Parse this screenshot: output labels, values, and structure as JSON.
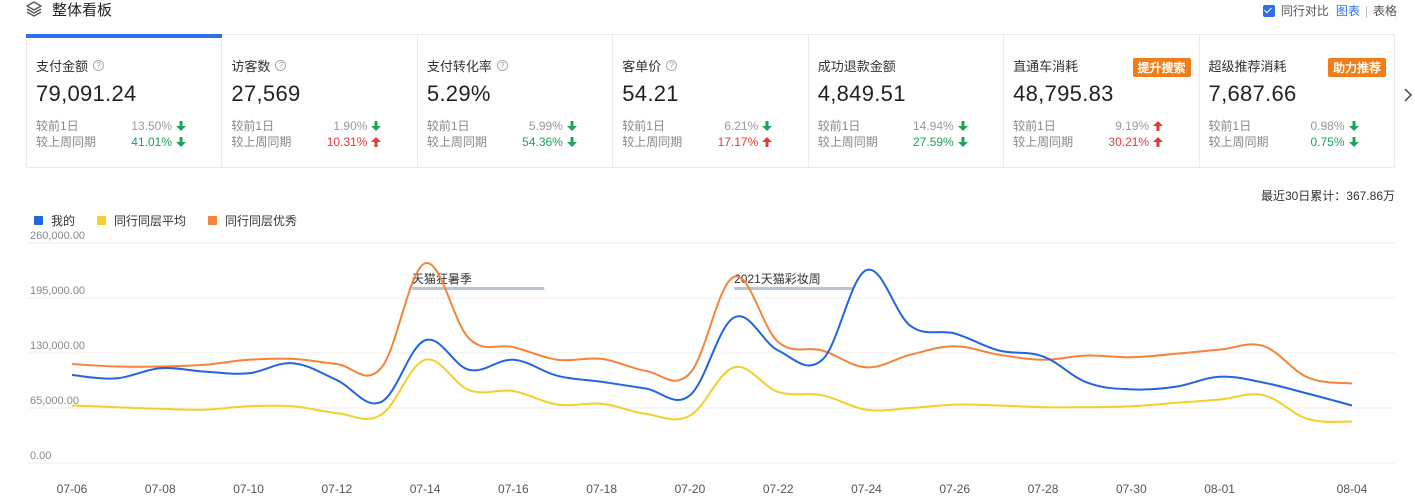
{
  "header": {
    "title": "整体看板",
    "compare_label": "同行对比",
    "view_chart": "图表",
    "separator": "|",
    "view_table": "表格"
  },
  "metrics": [
    {
      "name": "支付金额",
      "value": "79,091.24",
      "has_help": true,
      "badge": "",
      "day_label": "较前1日",
      "day_pct": "13.50%",
      "day_dir": "down",
      "week_label": "较上周同期",
      "week_pct": "41.01%",
      "week_dir": "down"
    },
    {
      "name": "访客数",
      "value": "27,569",
      "has_help": true,
      "badge": "",
      "day_label": "较前1日",
      "day_pct": "1.90%",
      "day_dir": "down",
      "week_label": "较上周同期",
      "week_pct": "10.31%",
      "week_dir": "up"
    },
    {
      "name": "支付转化率",
      "value": "5.29%",
      "has_help": true,
      "badge": "",
      "day_label": "较前1日",
      "day_pct": "5.99%",
      "day_dir": "down",
      "week_label": "较上周同期",
      "week_pct": "54.36%",
      "week_dir": "down"
    },
    {
      "name": "客单价",
      "value": "54.21",
      "has_help": true,
      "badge": "",
      "day_label": "较前1日",
      "day_pct": "6.21%",
      "day_dir": "down",
      "week_label": "较上周同期",
      "week_pct": "17.17%",
      "week_dir": "up"
    },
    {
      "name": "成功退款金额",
      "value": "4,849.51",
      "has_help": false,
      "badge": "",
      "day_label": "较前1日",
      "day_pct": "14.94%",
      "day_dir": "down",
      "week_label": "较上周同期",
      "week_pct": "27.59%",
      "week_dir": "down"
    },
    {
      "name": "直通车消耗",
      "value": "48,795.83",
      "has_help": false,
      "badge": "提升搜索",
      "day_label": "较前1日",
      "day_pct": "9.19%",
      "day_dir": "up",
      "week_label": "较上周同期",
      "week_pct": "30.21%",
      "week_dir": "up"
    },
    {
      "name": "超级推荐消耗",
      "value": "7,687.66",
      "has_help": false,
      "badge": "助力推荐",
      "day_label": "较前1日",
      "day_pct": "0.98%",
      "day_dir": "down",
      "week_label": "较上周同期",
      "week_pct": "0.75%",
      "week_dir": "down"
    }
  ],
  "colors": {
    "accent": "#2f6fea",
    "up": "#e53935",
    "down": "#1ea35a",
    "badge": "#f07d17"
  },
  "summary": "最近30日累计：367.86万",
  "chart_data": {
    "type": "line",
    "ylim": [
      0,
      260000
    ],
    "yticks": [
      "0.00",
      "65,000.00",
      "130,000.00",
      "195,000.00",
      "260,000.00"
    ],
    "ytick_values": [
      0,
      65000,
      130000,
      195000,
      260000
    ],
    "x": [
      "07-06",
      "07-07",
      "07-08",
      "07-09",
      "07-10",
      "07-11",
      "07-12",
      "07-13",
      "07-14",
      "07-15",
      "07-16",
      "07-17",
      "07-18",
      "07-19",
      "07-20",
      "07-21",
      "07-22",
      "07-23",
      "07-24",
      "07-25",
      "07-26",
      "07-27",
      "07-28",
      "07-29",
      "07-30",
      "07-31",
      "08-01",
      "08-02",
      "08-03",
      "08-04"
    ],
    "xtick_labels": [
      "07-06",
      "07-08",
      "07-10",
      "07-12",
      "07-14",
      "07-16",
      "07-18",
      "07-20",
      "07-22",
      "07-24",
      "07-26",
      "07-28",
      "07-30",
      "08-01",
      "08-04"
    ],
    "xtick_indices": [
      0,
      2,
      4,
      6,
      8,
      10,
      12,
      14,
      16,
      18,
      20,
      22,
      24,
      26,
      29
    ],
    "series": [
      {
        "name": "我的",
        "color": "#2364e0",
        "values": [
          104000,
          100000,
          112000,
          108000,
          106000,
          118000,
          98000,
          72000,
          145000,
          110000,
          122000,
          103000,
          96000,
          88000,
          80000,
          172000,
          133000,
          122000,
          228000,
          162000,
          153000,
          133000,
          126000,
          95000,
          87000,
          90000,
          102000,
          95000,
          82000,
          68000
        ]
      },
      {
        "name": "同行同层平均",
        "color": "#f2cf2a",
        "values": [
          68000,
          66000,
          64000,
          63000,
          67000,
          67000,
          59000,
          57000,
          122000,
          86000,
          85000,
          69000,
          70000,
          58000,
          56000,
          113000,
          84000,
          80000,
          63000,
          65000,
          69000,
          68000,
          66000,
          66000,
          67000,
          71000,
          75000,
          80000,
          52000,
          49000
        ]
      },
      {
        "name": "同行同层优秀",
        "color": "#f5833a",
        "values": [
          117000,
          114000,
          114000,
          116000,
          122000,
          123000,
          117000,
          112000,
          236000,
          147000,
          137000,
          122000,
          123000,
          109000,
          106000,
          220000,
          143000,
          133000,
          113000,
          128000,
          138000,
          128000,
          122000,
          127000,
          125000,
          129000,
          134000,
          138000,
          101000,
          94000
        ]
      }
    ],
    "annotations": [
      {
        "text": "天猫狂暑季",
        "start": 7.7,
        "end": 10.7
      },
      {
        "text": "2021天猫彩妆周",
        "start": 15.0,
        "end": 17.7
      }
    ],
    "legend": "top-left",
    "grid": "horizontal"
  }
}
